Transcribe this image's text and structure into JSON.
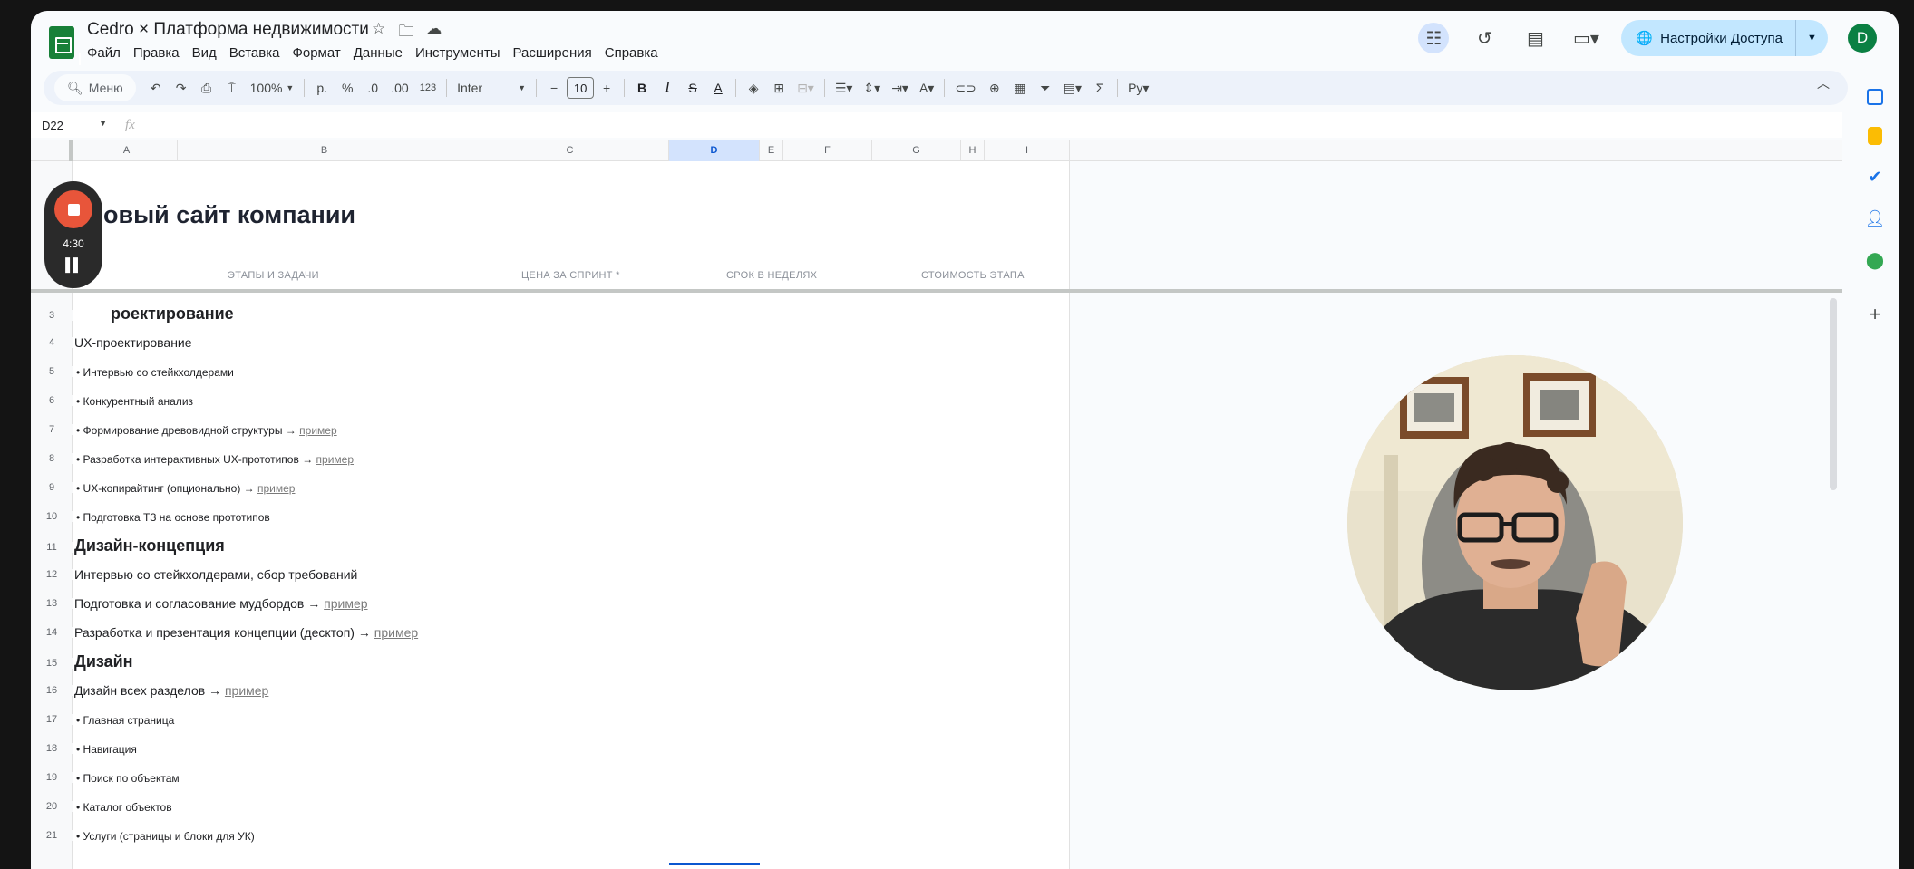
{
  "document": {
    "title": "Cedro × Платформа недвижимости",
    "menu": [
      "Файл",
      "Правка",
      "Вид",
      "Вставка",
      "Формат",
      "Данные",
      "Инструменты",
      "Расширения",
      "Справка"
    ]
  },
  "header": {
    "share_label": "Настройки Доступа",
    "avatar_letter": "D"
  },
  "toolbar": {
    "search_label": "Меню",
    "zoom": "100%",
    "currency": "р.",
    "percent": "%",
    "dec_decrease": ".0",
    "dec_increase": ".00",
    "number_format": "123",
    "font": "Inter",
    "font_size": "10",
    "bold": "B",
    "italic": "I",
    "strike": "S",
    "text_color": "A",
    "text_color2": "A",
    "functions": "Σ",
    "input_tools": "Ру"
  },
  "formula_bar": {
    "cell_ref": "D22",
    "fx": "fx",
    "value": ""
  },
  "columns": [
    "A",
    "B",
    "C",
    "D",
    "E",
    "F",
    "G",
    "H",
    "I"
  ],
  "sheet": {
    "title": "овый сайт компании",
    "col_labels": {
      "stages": "ЭТАПЫ И ЗАДАЧИ",
      "price": "ЦЕНА ЗА СПРИНТ *",
      "weeks": "СРОК В НЕДЕЛЯХ",
      "cost": "СТОИМОСТЬ ЭТАПА"
    },
    "rows": [
      {
        "num": "3",
        "type": "sec",
        "text": "роектирование"
      },
      {
        "num": "4",
        "type": "sub",
        "text": "UX-проектирование"
      },
      {
        "num": "5",
        "type": "item",
        "text": "• Интервью со стейкхолдерами"
      },
      {
        "num": "6",
        "type": "item",
        "text": "• Конкурентный анализ"
      },
      {
        "num": "7",
        "type": "item",
        "text": "• Формирование древовидной структуры →",
        "link": "пример"
      },
      {
        "num": "8",
        "type": "item",
        "text": "• Разработка интерактивных UX-прототипов →",
        "link": "пример"
      },
      {
        "num": "9",
        "type": "item",
        "text": "• UX-копирайтинг (опционально) →",
        "link": "пример"
      },
      {
        "num": "10",
        "type": "item",
        "text": "• Подготовка ТЗ на основе прототипов"
      },
      {
        "num": "11",
        "type": "sec",
        "text": "Дизайн-концепция"
      },
      {
        "num": "12",
        "type": "sub",
        "text": "Интервью со стейкхолдерами, сбор требований"
      },
      {
        "num": "13",
        "type": "sub",
        "text": "Подготовка и согласование мудбордов →",
        "link": "пример"
      },
      {
        "num": "14",
        "type": "sub",
        "text": "Разработка и презентация концепции (десктоп) →",
        "link": "пример"
      },
      {
        "num": "15",
        "type": "sec",
        "text": "Дизайн"
      },
      {
        "num": "16",
        "type": "sub",
        "text": "Дизайн всех разделов →",
        "link": "пример"
      },
      {
        "num": "17",
        "type": "item",
        "text": "• Главная страница"
      },
      {
        "num": "18",
        "type": "item",
        "text": "• Навигация"
      },
      {
        "num": "19",
        "type": "item",
        "text": "• Поиск по объектам"
      },
      {
        "num": "20",
        "type": "item",
        "text": "• Каталог объектов"
      },
      {
        "num": "21",
        "type": "item",
        "text": "• Услуги (страницы и блоки для УК)"
      }
    ]
  },
  "recorder": {
    "time": "4:30"
  },
  "colors": {
    "sheets_green": "#188038",
    "share_bg": "#c2e7ff",
    "selected_col": "#d3e3fd",
    "record_red": "#e8553a"
  }
}
